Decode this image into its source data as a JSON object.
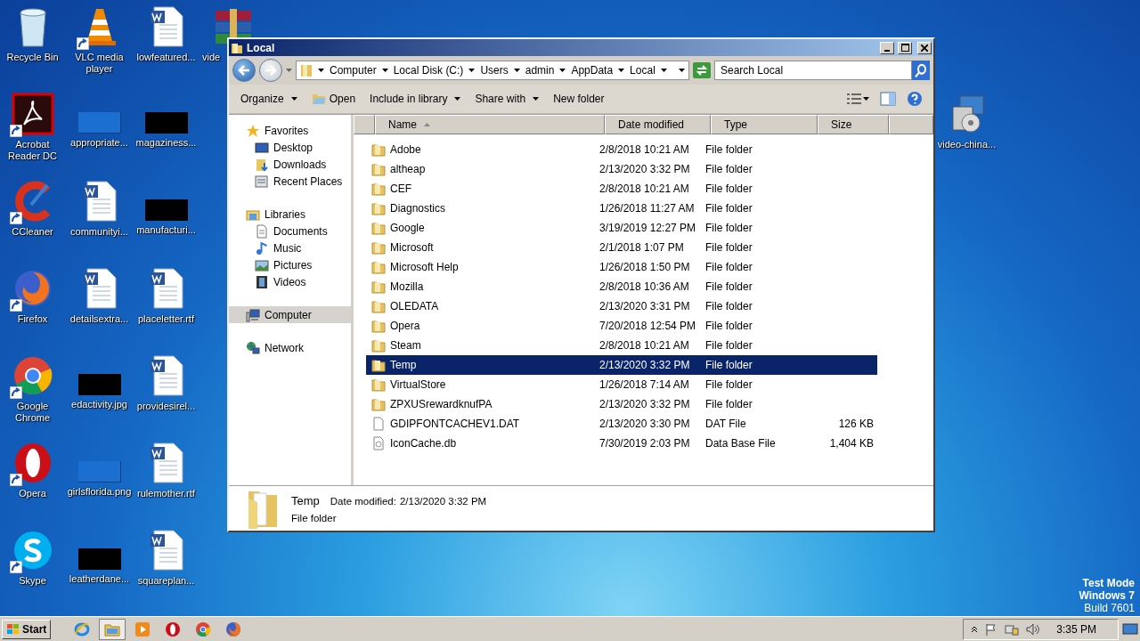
{
  "desktop": {
    "icons": [
      {
        "label": "Recycle Bin",
        "kind": "recycle"
      },
      {
        "label": "Acrobat Reader DC",
        "kind": "acrobat"
      },
      {
        "label": "CCleaner",
        "kind": "ccleaner"
      },
      {
        "label": "Firefox",
        "kind": "firefox"
      },
      {
        "label": "Google Chrome",
        "kind": "chrome"
      },
      {
        "label": "Opera",
        "kind": "opera"
      },
      {
        "label": "Skype",
        "kind": "skype"
      },
      {
        "label": "VLC media player",
        "kind": "vlc"
      },
      {
        "label": "appropriate...",
        "kind": "blank"
      },
      {
        "label": "communityi...",
        "kind": "word"
      },
      {
        "label": "detailsextra...",
        "kind": "word"
      },
      {
        "label": "edactivity.jpg",
        "kind": "dark"
      },
      {
        "label": "girlsflorida.png",
        "kind": "blank"
      },
      {
        "label": "leatherdane...",
        "kind": "dark"
      },
      {
        "label": "lowfeatured...",
        "kind": "word"
      },
      {
        "label": "magaziness...",
        "kind": "dark"
      },
      {
        "label": "manufacturi...",
        "kind": "dark"
      },
      {
        "label": "placeletter.rtf",
        "kind": "word"
      },
      {
        "label": "providesirel...",
        "kind": "word"
      },
      {
        "label": "rulemother.rtf",
        "kind": "word"
      },
      {
        "label": "squareplan...",
        "kind": "word"
      },
      {
        "label": "vide",
        "kind": "archive"
      }
    ],
    "right_icons": [
      {
        "label": "video-china...",
        "kind": "installer"
      }
    ]
  },
  "window": {
    "title": "Local",
    "breadcrumb": [
      "Computer",
      "Local Disk (C:)",
      "Users",
      "admin",
      "AppData",
      "Local"
    ],
    "search": {
      "placeholder": "Search Local"
    },
    "toolbar": [
      {
        "label": "Organize",
        "kind": "menu"
      },
      {
        "label": "Open",
        "kind": "icon"
      },
      {
        "label": "Include in library",
        "kind": "menu"
      },
      {
        "label": "Share with",
        "kind": "menu"
      },
      {
        "label": "New folder",
        "kind": "plain"
      }
    ],
    "nav": [
      {
        "label": "Favorites",
        "kind": "star",
        "selected": false,
        "children": [
          {
            "label": "Desktop",
            "kind": "desktop",
            "selected": false
          },
          {
            "label": "Downloads",
            "kind": "downloads",
            "selected": false
          },
          {
            "label": "Recent Places",
            "kind": "recent",
            "selected": false
          }
        ]
      },
      {
        "label": "Libraries",
        "kind": "libraries",
        "selected": false,
        "children": [
          {
            "label": "Documents",
            "kind": "documents",
            "selected": false
          },
          {
            "label": "Music",
            "kind": "music",
            "selected": false
          },
          {
            "label": "Pictures",
            "kind": "pictures",
            "selected": false
          },
          {
            "label": "Videos",
            "kind": "videos",
            "selected": false
          }
        ]
      },
      {
        "label": "Computer",
        "kind": "computer",
        "selected": true
      },
      {
        "label": "Network",
        "kind": "network",
        "selected": false
      }
    ],
    "columns": [
      {
        "label": "Name",
        "sorted": true
      },
      {
        "label": "Date modified",
        "sorted": false
      },
      {
        "label": "Type",
        "sorted": false
      },
      {
        "label": "Size",
        "sorted": false
      }
    ],
    "rows": [
      {
        "name": "Adobe",
        "date": "2/8/2018 10:21 AM",
        "type": "File folder",
        "kind": "folder",
        "selected": false
      },
      {
        "name": "altheap",
        "date": "2/13/2020 3:32 PM",
        "type": "File folder",
        "kind": "folder",
        "selected": false
      },
      {
        "name": "CEF",
        "date": "2/8/2018 10:21 AM",
        "type": "File folder",
        "kind": "folder",
        "selected": false
      },
      {
        "name": "Diagnostics",
        "date": "1/26/2018 11:27 AM",
        "type": "File folder",
        "kind": "folder",
        "selected": false
      },
      {
        "name": "Google",
        "date": "3/19/2019 12:27 PM",
        "type": "File folder",
        "kind": "folder",
        "selected": false
      },
      {
        "name": "Microsoft",
        "date": "2/1/2018 1:07 PM",
        "type": "File folder",
        "kind": "folder",
        "selected": false
      },
      {
        "name": "Microsoft Help",
        "date": "1/26/2018 1:50 PM",
        "type": "File folder",
        "kind": "folder",
        "selected": false
      },
      {
        "name": "Mozilla",
        "date": "2/8/2018 10:36 AM",
        "type": "File folder",
        "kind": "folder",
        "selected": false
      },
      {
        "name": "OLEDATA",
        "date": "2/13/2020 3:31 PM",
        "type": "File folder",
        "kind": "folder",
        "selected": false
      },
      {
        "name": "Opera",
        "date": "7/20/2018 12:54 PM",
        "type": "File folder",
        "kind": "folder",
        "selected": false
      },
      {
        "name": "Steam",
        "date": "2/8/2018 10:21 AM",
        "type": "File folder",
        "kind": "folder",
        "selected": false
      },
      {
        "name": "Temp",
        "date": "2/13/2020 3:32 PM",
        "type": "File folder",
        "kind": "folder",
        "selected": true
      },
      {
        "name": "VirtualStore",
        "date": "1/26/2018 7:14 AM",
        "type": "File folder",
        "kind": "folder",
        "selected": false
      },
      {
        "name": "ZPXUSrewardknufPA",
        "date": "2/13/2020 3:32 PM",
        "type": "File folder",
        "kind": "folder",
        "selected": false
      },
      {
        "name": "GDIPFONTCACHEV1.DAT",
        "date": "2/13/2020 3:30 PM",
        "type": "DAT File",
        "size": "126 KB",
        "kind": "file",
        "selected": false
      },
      {
        "name": "IconCache.db",
        "date": "7/30/2019 2:03 PM",
        "type": "Data Base File",
        "size": "1,404 KB",
        "kind": "db",
        "selected": false
      }
    ],
    "details": {
      "name": "Temp",
      "type": "File folder",
      "date_label": "Date modified:",
      "date": "2/13/2020 3:32 PM"
    }
  },
  "taskbar": {
    "start": "Start",
    "apps": [
      {
        "kind": "ie",
        "selected": false
      },
      {
        "kind": "explorer",
        "selected": true
      },
      {
        "kind": "media",
        "selected": false
      },
      {
        "kind": "opera",
        "selected": false
      },
      {
        "kind": "chrome",
        "selected": false
      },
      {
        "kind": "firefox",
        "selected": false
      }
    ],
    "clock": "3:35 PM"
  },
  "test_mode": [
    "Test Mode",
    "Windows 7",
    "Build 7601"
  ]
}
